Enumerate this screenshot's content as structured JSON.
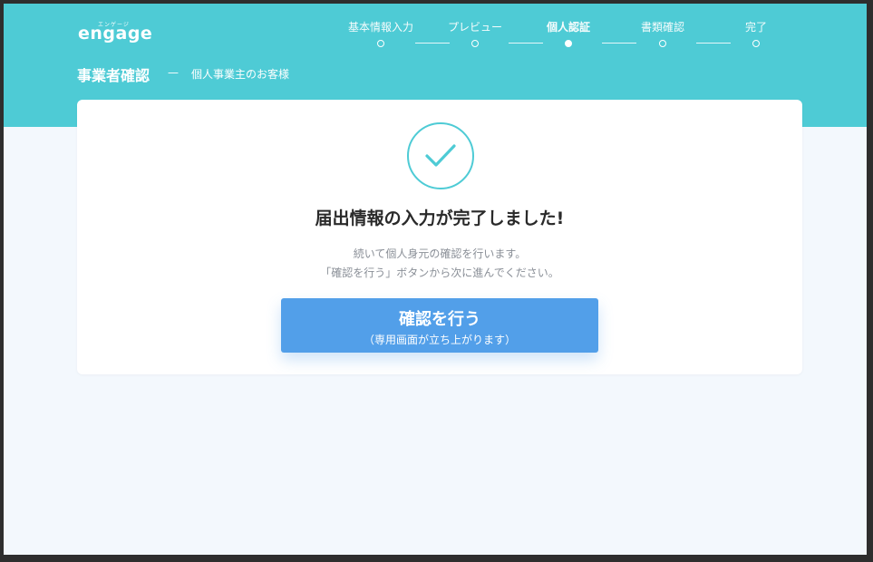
{
  "header": {
    "logo": {
      "small_text": "エンゲージ",
      "main_text": "engage"
    },
    "steps": [
      {
        "label": "基本情報入力",
        "state": "done"
      },
      {
        "label": "プレビュー",
        "state": "done"
      },
      {
        "label": "個人認証",
        "state": "current"
      },
      {
        "label": "書類確認",
        "state": "todo"
      },
      {
        "label": "完了",
        "state": "todo"
      }
    ],
    "page_title": "事業者確認",
    "page_dash": "—",
    "page_subtitle": "個人事業主のお客様"
  },
  "card": {
    "icon": "check-icon",
    "title": "届出情報の入力が完了しました!",
    "description_lines": [
      "続いて個人身元の確認を行います。",
      "「確認を行う」ボタンから次に進んでください。"
    ],
    "button": {
      "label": "確認を行う",
      "sub_label": "（専用画面が立ち上がります）"
    }
  },
  "colors": {
    "header_bg": "#4ecbd5",
    "page_bg": "#f3f8fd",
    "accent": "#4ecbd5",
    "button_bg": "#529fe9",
    "title_text": "#2a2a2a",
    "muted_text": "#8a8f97"
  }
}
